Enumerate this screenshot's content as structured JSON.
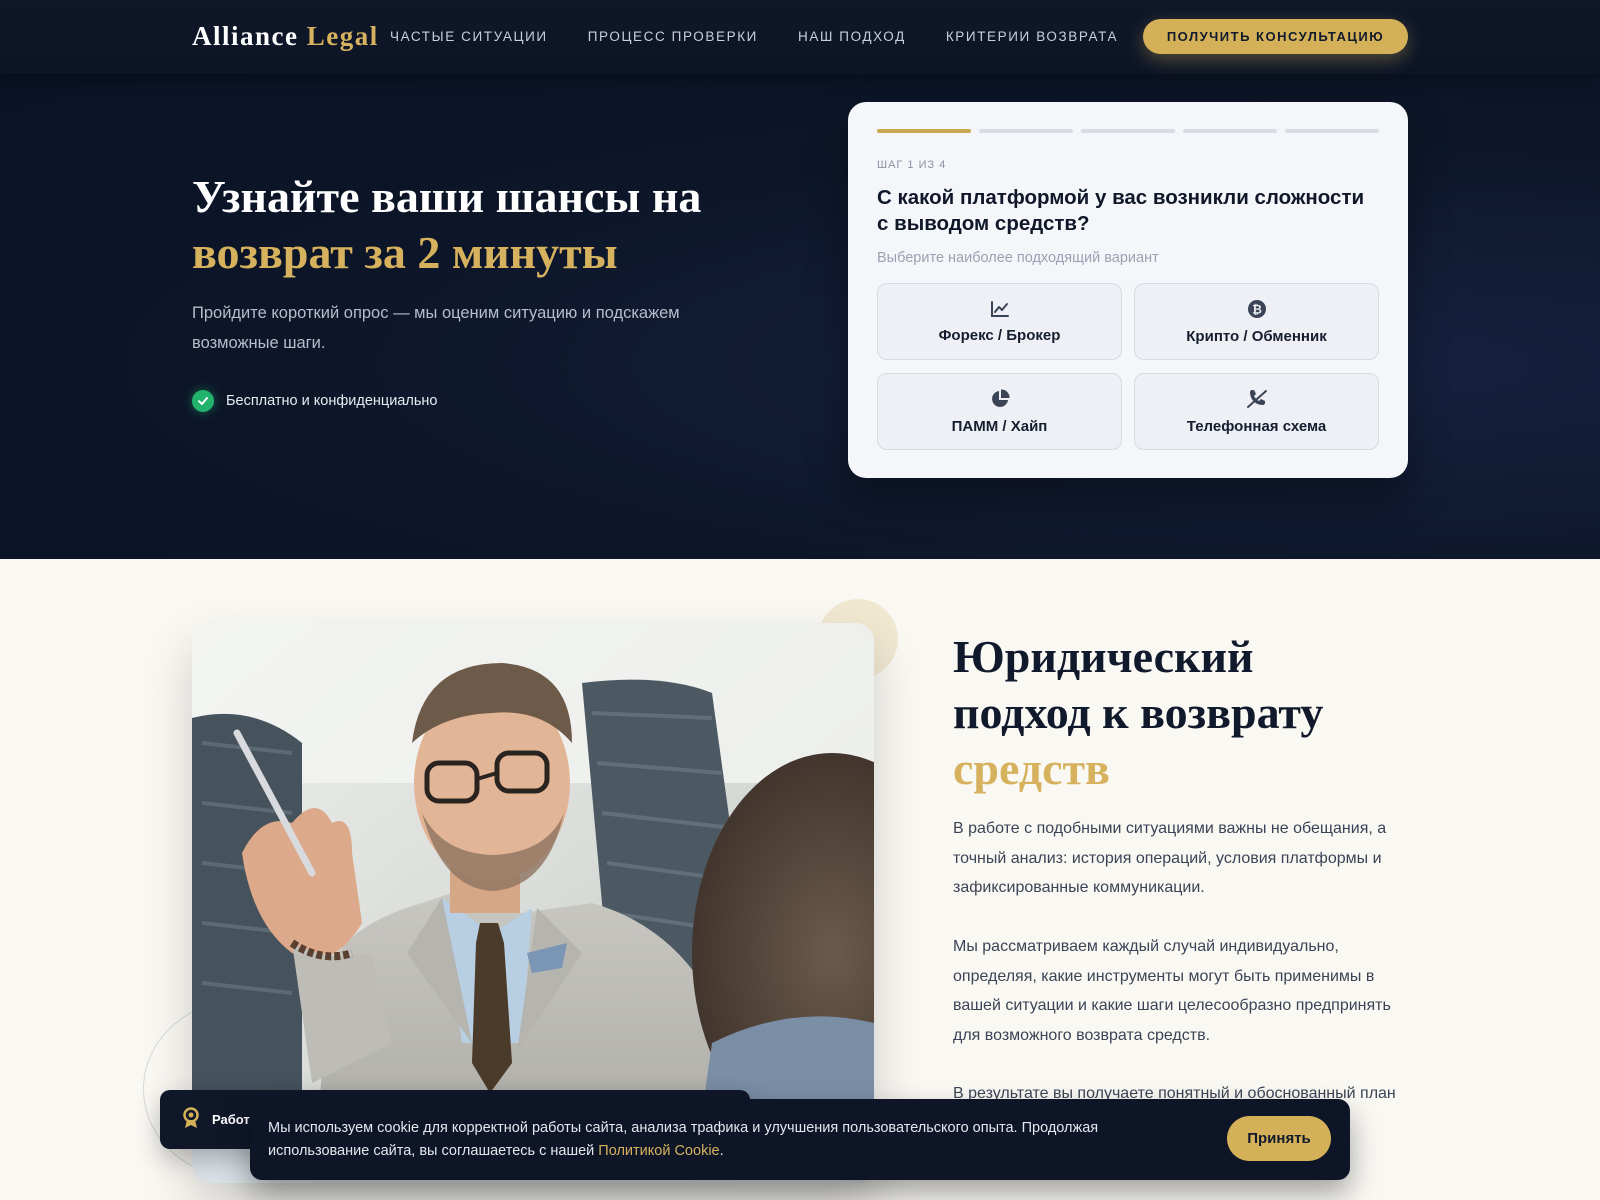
{
  "header": {
    "logo_primary": "Alliance",
    "logo_accent": "Legal",
    "nav": [
      {
        "label": "ЧАСТЫЕ СИТУАЦИИ"
      },
      {
        "label": "ПРОЦЕСС ПРОВЕРКИ"
      },
      {
        "label": "НАШ ПОДХОД"
      },
      {
        "label": "КРИТЕРИИ ВОЗВРАТА"
      }
    ],
    "cta_label": "ПОЛУЧИТЬ КОНСУЛЬТАЦИЮ"
  },
  "hero": {
    "title_line1": "Узнайте ваши шансы на",
    "title_line2": "возврат за 2 минуты",
    "subtitle": "Пройдите короткий опрос — мы оценим ситуацию и подскажем возможные шаги.",
    "badge": "Бесплатно и конфиденциально"
  },
  "quiz": {
    "progress_total": 5,
    "progress_active": 1,
    "step_label": "ШАГ 1 ИЗ 4",
    "question": "С какой платформой у вас возникли сложности с выводом средств?",
    "hint": "Выберите наиболее подходящий вариант",
    "options": [
      {
        "label": "Форекс / Брокер",
        "icon": "chart-line-icon"
      },
      {
        "label": "Крипто / Обменник",
        "icon": "bitcoin-icon"
      },
      {
        "label": "ПАММ / Хайп",
        "icon": "pie-chart-icon"
      },
      {
        "label": "Телефонная схема",
        "icon": "phone-slash-icon"
      }
    ]
  },
  "about": {
    "title_line1": "Юридический",
    "title_line2": "подход к возврату",
    "title_line3": "средств",
    "paragraph1": "В работе с подобными ситуациями важны не обещания, а точный анализ: история операций, условия платформы и зафиксированные коммуникации.",
    "paragraph2": "Мы рассматриваем каждый случай индивидуально, определяя, какие инструменты могут быть применимы в вашей ситуации и какие шаги целесообразно предпринять для возможного возврата средств.",
    "paragraph3": "В результате вы получаете понятный и обоснованный план",
    "chip_label": "Работа"
  },
  "cookie": {
    "text": "Мы используем cookie для корректной работы сайта, анализа трафика и улучшения пользовательского опыта. Продолжая использование сайта, вы соглашаетесь с нашей",
    "link": "Политикой Cookie",
    "after_link": ".",
    "accept": "Принять"
  },
  "colors": {
    "navy": "#0f1729",
    "gold": "#d4b159",
    "cream": "#faf8f3",
    "success": "#22b26b"
  }
}
